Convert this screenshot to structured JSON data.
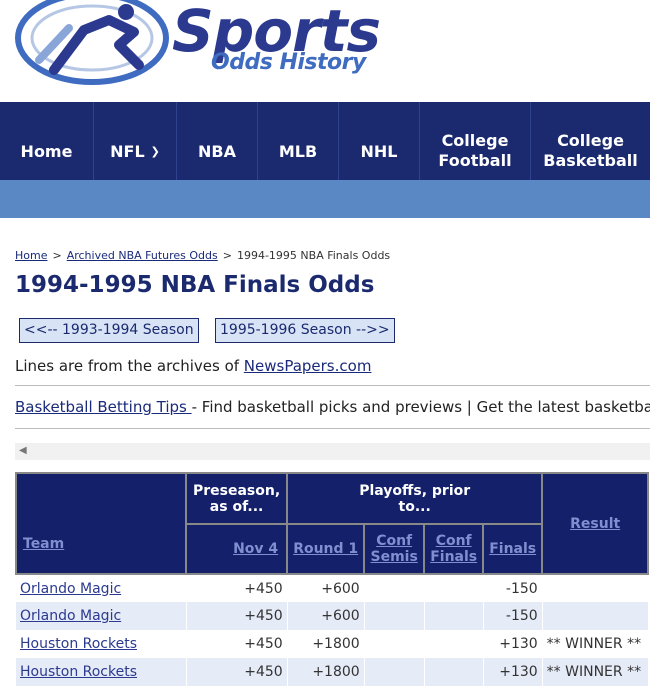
{
  "logo": {
    "word": "Sports",
    "sub": "Odds History"
  },
  "nav": [
    {
      "label": "Home"
    },
    {
      "label": "NFL",
      "dropdown": true
    },
    {
      "label": "NBA"
    },
    {
      "label": "MLB"
    },
    {
      "label": "NHL"
    },
    {
      "label": "College\nFootball"
    },
    {
      "label": "College\nBasketball"
    }
  ],
  "breadcrumb": {
    "home": "Home",
    "archived": "Archived NBA Futures Odds",
    "current": "1994-1995 NBA Finals Odds",
    "separator": ">"
  },
  "page_title": "1994-1995 NBA Finals Odds",
  "prev_season": "<<-- 1993-1994 Season",
  "next_season": "1995-1996 Season -->>",
  "lines_text": "Lines are from the archives of ",
  "lines_link": "NewsPapers.com",
  "tips_link": "Basketball Betting Tips ",
  "tips_text": "- Find basketball picks and previews | Get the latest basketball betting",
  "table": {
    "headers": {
      "team": "Team",
      "preseason": "Preseason, as of...",
      "playoffs": "Playoffs, prior to...",
      "result": "Result",
      "nov4": "Nov 4",
      "round1": "Round 1",
      "conf_semis": "Conf Semis",
      "conf_finals": "Conf Finals",
      "finals": "Finals"
    },
    "rows": [
      {
        "team": "Orlando Magic",
        "nov4": "+450",
        "round1": "+600",
        "conf_semis": "",
        "conf_finals": "",
        "finals": "-150",
        "result": ""
      },
      {
        "team": "Orlando Magic",
        "nov4": "+450",
        "round1": "+600",
        "conf_semis": "",
        "conf_finals": "",
        "finals": "-150",
        "result": ""
      },
      {
        "team": "Houston Rockets",
        "nov4": "+450",
        "round1": "+1800",
        "conf_semis": "",
        "conf_finals": "",
        "finals": "+130",
        "result": "** WINNER **"
      },
      {
        "team": "Houston Rockets",
        "nov4": "+450",
        "round1": "+1800",
        "conf_semis": "",
        "conf_finals": "",
        "finals": "+130",
        "result": "** WINNER **"
      }
    ]
  },
  "colors": {
    "nav_bg": "#1b2a6e",
    "subnav_bg": "#5a88c4",
    "title": "#1b2a6e",
    "table_header_bg": "#14216a",
    "row_alt": "#e6ebf8"
  }
}
